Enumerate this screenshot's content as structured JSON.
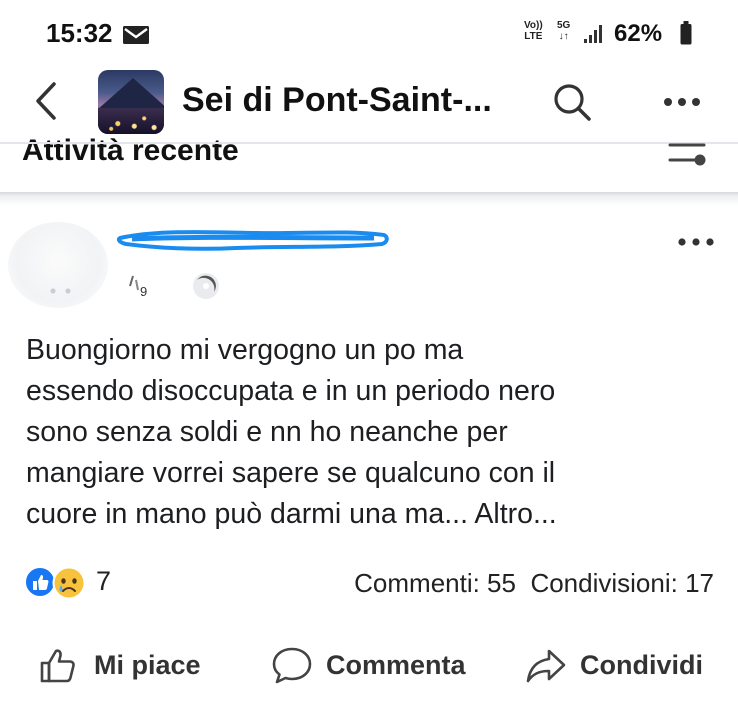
{
  "status_bar": {
    "time": "15:32",
    "network_line1": "Vo))",
    "network_line2": "LTE",
    "fiveg_line1": "5G",
    "fiveg_line2": "↓↑",
    "battery": "62%",
    "icons": [
      "mail-icon",
      "signal-icon",
      "battery-icon"
    ]
  },
  "header": {
    "group_name": "Sei di Pont-Saint-...",
    "icons": [
      "back-icon",
      "search-icon",
      "more-icon"
    ]
  },
  "section": {
    "title": "Attività recente",
    "icon": "filter-icon"
  },
  "post": {
    "text_lines": [
      "Buongiorno mi vergogno  un po ma",
      "essendo disoccupata  e in un periodo  nero",
      "sono senza soldi e nn ho neanche  per",
      "mangiare  vorrei sapere se qualcuno  con il",
      "cuore in mano può darmi  una ma..."
    ],
    "more_label": "Altro...",
    "reaction_count": "7",
    "comments": "Commenti: 55",
    "shares": "Condivisioni: 17"
  },
  "actions": {
    "like": "Mi piace",
    "comment": "Commenta",
    "share": "Condividi"
  },
  "colors": {
    "like_blue": "#1877f2",
    "scribble_blue": "#1a8cf0",
    "sad_yellow": "#f7c33c",
    "text": "#1c1e21"
  }
}
